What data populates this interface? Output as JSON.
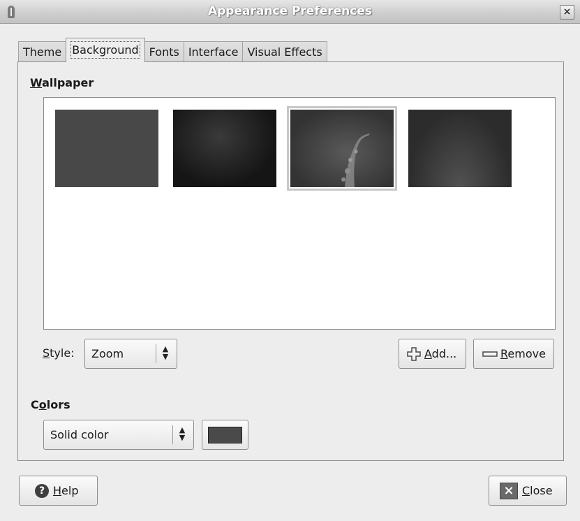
{
  "window": {
    "title": "Appearance Preferences"
  },
  "tabs": [
    {
      "label": "Theme"
    },
    {
      "label": "Background"
    },
    {
      "label": "Fonts"
    },
    {
      "label": "Interface"
    },
    {
      "label": "Visual Effects"
    }
  ],
  "wallpaper": {
    "section_mnemonic": "W",
    "section_rest": "allpaper",
    "selected_index": 2,
    "style_mnemonic": "S",
    "style_rest": "tyle:",
    "style_value": "Zoom",
    "add_mnemonic": "A",
    "add_rest": "dd...",
    "remove_mnemonic": "R",
    "remove_rest": "emove"
  },
  "colors": {
    "section_pre": "C",
    "section_mnemonic": "o",
    "section_rest": "lors",
    "mode_value": "Solid color",
    "swatch_color": "#4a4a4a"
  },
  "footer": {
    "help_mnemonic": "H",
    "help_rest": "elp",
    "close_mnemonic": "C",
    "close_rest": "lose"
  },
  "icons": {
    "window_menu": "window-menu-icon",
    "window_close": "window-close-icon",
    "add": "plus-icon",
    "remove": "minus-icon",
    "help": "help-icon",
    "close": "close-icon"
  }
}
